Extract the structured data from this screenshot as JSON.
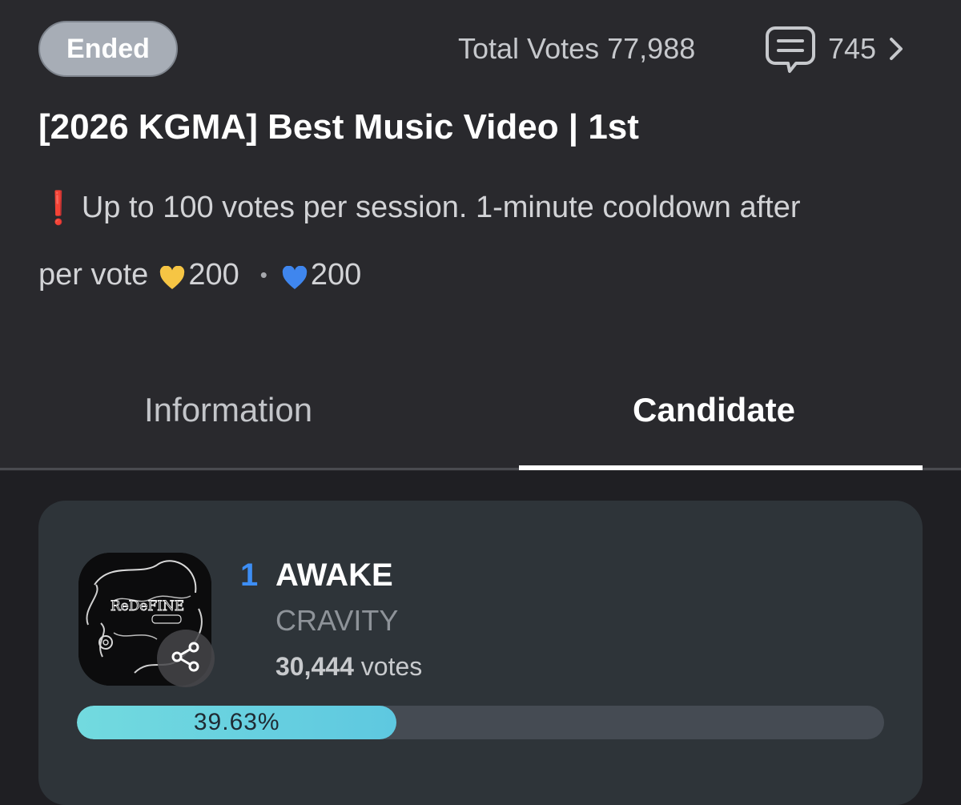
{
  "header": {
    "status": "Ended",
    "total_votes_label": "Total Votes",
    "total_votes_value": "77,988",
    "comment_count": "745"
  },
  "event": {
    "title": "[2026 KGMA] Best Music Video | 1st",
    "notice_mark": "❗",
    "notice_text": "Up to 100 votes per session. 1-minute cooldown after",
    "cost_label": "per vote",
    "gold_heart_cost": "200",
    "separator": "•",
    "blue_heart_cost": "200"
  },
  "tabs": [
    {
      "label": "Information",
      "active": false
    },
    {
      "label": "Candidate",
      "active": true
    }
  ],
  "candidate": {
    "rank": "1",
    "song": "AWAKE",
    "artist": "CRAVITY",
    "vote_count": "30,444",
    "vote_unit": "votes",
    "percent_label": "39.63%",
    "percent_value": 0.3963,
    "album_art_text": "ReDeFINE"
  },
  "colors": {
    "accent_rank": "#3d8ef5",
    "progress": "#6dd6de",
    "gold_heart": "#f6c544",
    "blue_heart": "#3f86ee"
  },
  "icons": {
    "comment": "chat-bubble-icon",
    "chevron": "chevron-right-icon",
    "share": "share-icon",
    "gold_heart": "gold-heart-icon",
    "blue_heart": "blue-heart-icon"
  }
}
